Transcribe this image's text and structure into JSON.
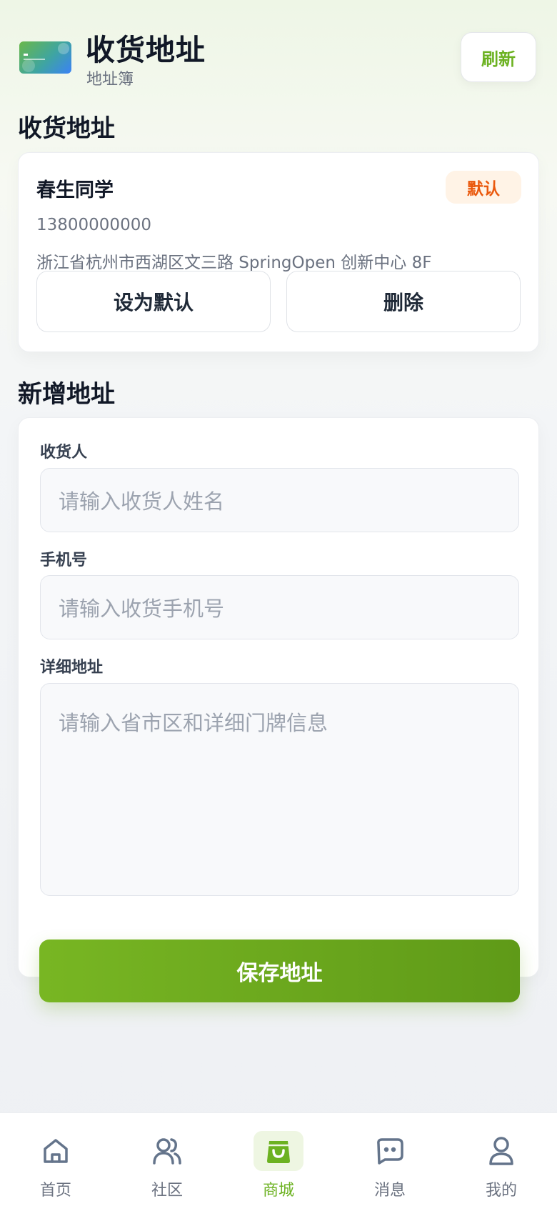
{
  "header": {
    "title": "收货地址",
    "subtitle": "地址簿",
    "refresh_label": "刷新"
  },
  "saved_section": {
    "title": "收货地址",
    "address": {
      "name": "春生同学",
      "badge": "默认",
      "phone": "13800000000",
      "detail": "浙江省杭州市西湖区文三路 SpringOpen 创新中心 8F",
      "set_default_label": "设为默认",
      "delete_label": "删除"
    }
  },
  "new_section": {
    "title": "新增地址",
    "recipient": {
      "label": "收货人",
      "placeholder": "请输入收货人姓名",
      "value": ""
    },
    "phone": {
      "label": "手机号",
      "placeholder": "请输入收货手机号",
      "value": ""
    },
    "detail": {
      "label": "详细地址",
      "placeholder": "请输入省市区和详细门牌信息",
      "value": ""
    },
    "save_label": "保存地址"
  },
  "tabbar": {
    "items": [
      {
        "label": "首页",
        "icon": "home-icon",
        "active": false
      },
      {
        "label": "社区",
        "icon": "users-icon",
        "active": false
      },
      {
        "label": "商城",
        "icon": "shopping-bag-icon",
        "active": true
      },
      {
        "label": "消息",
        "icon": "message-icon",
        "active": false
      },
      {
        "label": "我的",
        "icon": "user-icon",
        "active": false
      }
    ]
  },
  "colors": {
    "accent": "#6cb221",
    "badge_text": "#ea580c",
    "badge_bg": "#fff3e6"
  }
}
